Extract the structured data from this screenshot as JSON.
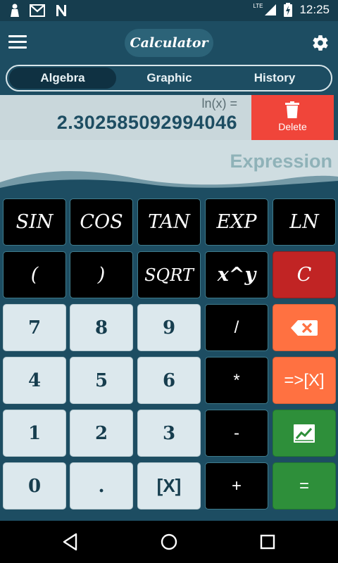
{
  "status_bar": {
    "time": "12:25",
    "network": "LTE",
    "icons": [
      "notification-icon",
      "gmail-icon",
      "n-app-icon",
      "signal-icon",
      "battery-charging-icon"
    ]
  },
  "app_bar": {
    "title": "Calculator",
    "menu_icon": "hamburger-menu-icon",
    "settings_icon": "gear-icon"
  },
  "tabs": [
    {
      "label": "Algebra",
      "active": true
    },
    {
      "label": "Graphic",
      "active": false
    },
    {
      "label": "History",
      "active": false
    }
  ],
  "result": {
    "expression_label": "ln(x) =",
    "value": "2.302585092994046"
  },
  "delete_button": {
    "label": "Delete",
    "icon": "trash-icon"
  },
  "expression": {
    "placeholder": "Expression"
  },
  "keys": {
    "sin": "SIN",
    "cos": "COS",
    "tan": "TAN",
    "exp": "EXP",
    "ln": "LN",
    "open_paren": "(",
    "close_paren": ")",
    "sqrt": "SQRT",
    "power": "x^y",
    "clear": "C",
    "seven": "7",
    "eight": "8",
    "nine": "9",
    "divide": "/",
    "backspace": "backspace-icon",
    "four": "4",
    "five": "5",
    "six": "6",
    "multiply": "*",
    "store_x": "=>[X]",
    "one": "1",
    "two": "2",
    "three": "3",
    "subtract": "-",
    "graph": "chart-icon",
    "zero": "0",
    "decimal": ".",
    "var_x": "[X]",
    "add": "+",
    "equals": "="
  },
  "colors": {
    "primary": "#1d4d62",
    "delete": "#f0453a",
    "clear": "#c12424",
    "orange": "#ff7141",
    "green": "#2e8f3a"
  },
  "nav_bar": {
    "icons": [
      "back-icon",
      "home-icon",
      "recents-icon"
    ]
  }
}
